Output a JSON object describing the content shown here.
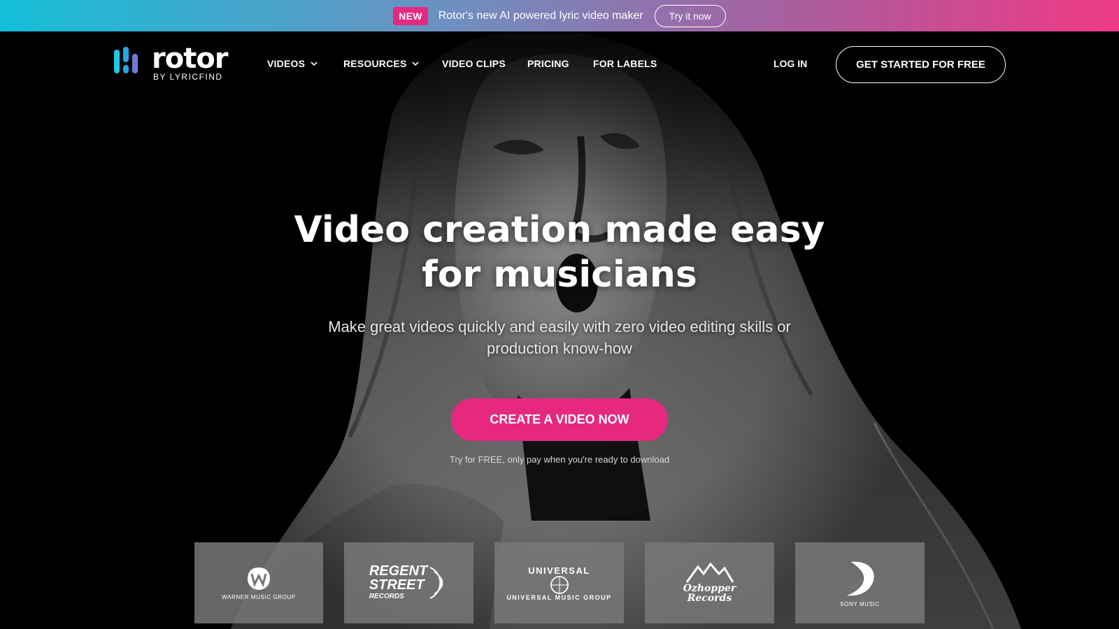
{
  "announcement": {
    "badge": "NEW",
    "message": "Rotor's new AI powered lyric video maker",
    "button_label": "Try it now"
  },
  "brand": {
    "name": "rotor",
    "tagline": "BY LYRICFIND",
    "logo_colors": [
      "#1ec8e6",
      "#22a9e4",
      "#6f7bd6"
    ]
  },
  "nav": {
    "items": [
      {
        "label": "VIDEOS",
        "has_dropdown": true
      },
      {
        "label": "RESOURCES",
        "has_dropdown": true
      },
      {
        "label": "VIDEO CLIPS",
        "has_dropdown": false
      },
      {
        "label": "PRICING",
        "has_dropdown": false
      },
      {
        "label": "FOR LABELS",
        "has_dropdown": false
      }
    ],
    "login_label": "LOG IN",
    "cta_label": "GET STARTED FOR FREE"
  },
  "hero": {
    "headline": "Video creation made easy for musicians",
    "subheadline": "Make great videos quickly and easily with zero video editing skills or production know-how",
    "cta_label": "CREATE A VIDEO NOW",
    "note": "Try for FREE, only pay when you're ready to download"
  },
  "labels": [
    {
      "name": "warner-music-group",
      "caption": "WARNER MUSIC GROUP"
    },
    {
      "name": "regent-street-records",
      "line1": "REGENT",
      "line2": "STREET",
      "line3": "RECORDS"
    },
    {
      "name": "universal-music-group",
      "top": "UNIVERSAL",
      "bottom": "UNIVERSAL MUSIC GROUP"
    },
    {
      "name": "ozhopper-records",
      "line1": "Ozhopper",
      "line2": "Records"
    },
    {
      "name": "sony-music",
      "caption": "SONY MUSIC"
    }
  ],
  "colors": {
    "accent": "#e6287f",
    "announce_gradient_start": "#14bfd8",
    "announce_gradient_end": "#ef3b86",
    "background": "#000000"
  }
}
